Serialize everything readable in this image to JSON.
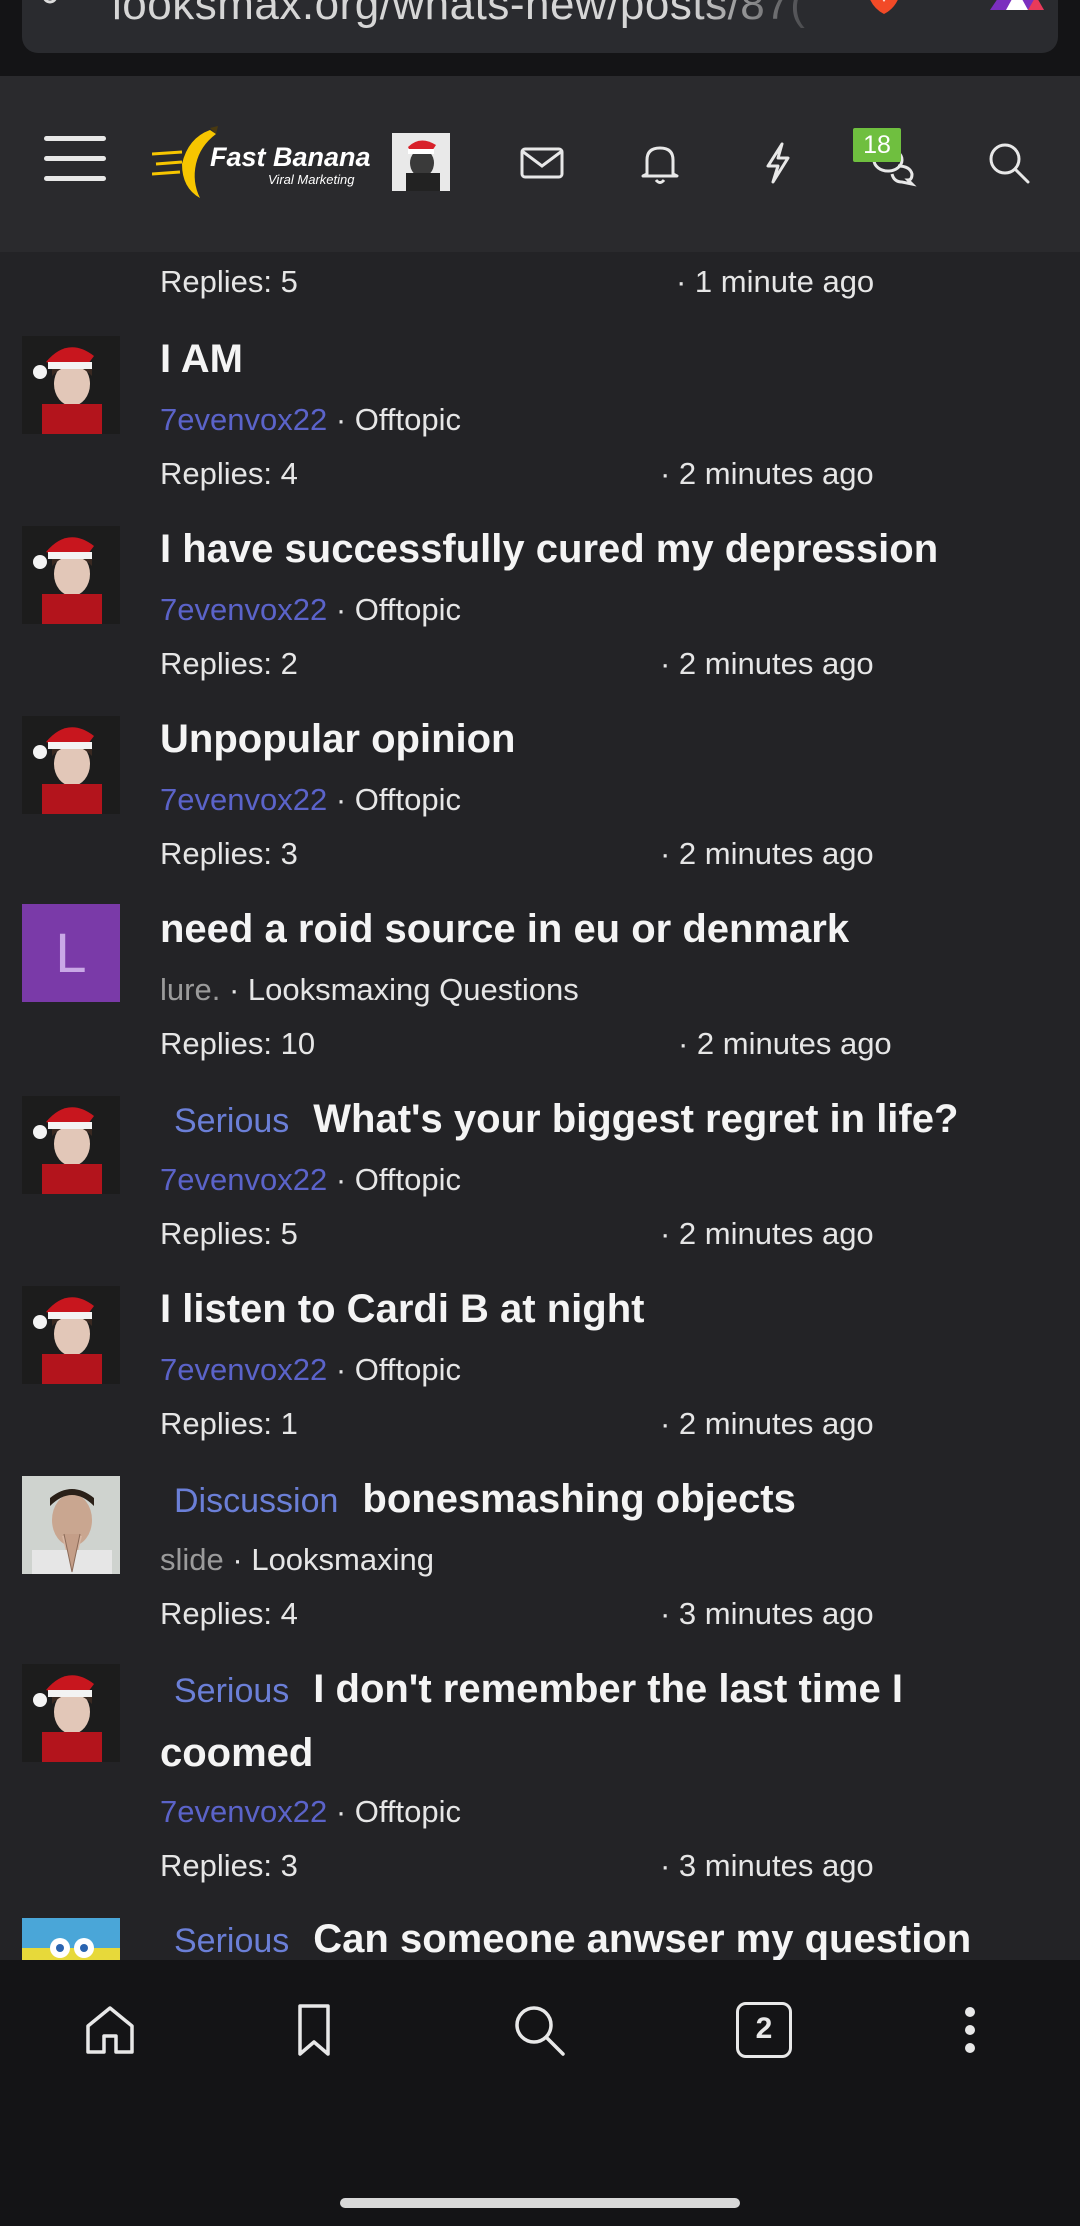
{
  "browser": {
    "url": "looksmax.org/whats-new/posts/87(",
    "tabs_count": "2"
  },
  "header": {
    "logo_title": "Fast Banana",
    "logo_subtitle": "Viral Marketing",
    "alerts_badge": "18"
  },
  "feed": {
    "top_partial": {
      "replies": "Replies: 5",
      "time": "· 1 minute ago"
    },
    "items": [
      {
        "title": "I AM",
        "prefix": "",
        "author": "7evenvox22",
        "forum": "· Offtopic",
        "replies": "Replies: 4",
        "time": "· 2 minutes ago"
      },
      {
        "title": "I have successfully cured my depression",
        "prefix": "",
        "author": "7evenvox22",
        "forum": "· Offtopic",
        "replies": "Replies: 2",
        "time": "· 2 minutes ago"
      },
      {
        "title": "Unpopular opinion",
        "prefix": "",
        "author": "7evenvox22",
        "forum": "· Offtopic",
        "replies": "Replies: 3",
        "time": "· 2 minutes ago"
      },
      {
        "title": "need a roid source in eu or denmark",
        "prefix": "",
        "author": "lure.",
        "forum": "· Looksmaxing Questions",
        "replies": "Replies: 10",
        "time": "· 2 minutes ago",
        "avatar_letter": "L"
      },
      {
        "title": "What's your biggest regret in life?",
        "prefix": "Serious",
        "author": "7evenvox22",
        "forum": "· Offtopic",
        "replies": "Replies: 5",
        "time": "· 2 minutes ago"
      },
      {
        "title": "I listen to Cardi B at night",
        "prefix": "",
        "author": "7evenvox22",
        "forum": "· Offtopic",
        "replies": "Replies: 1",
        "time": "· 2 minutes ago"
      },
      {
        "title": "bonesmashing objects",
        "prefix": "Discussion",
        "author": "slide",
        "forum": "· Looksmaxing",
        "replies": "Replies: 4",
        "time": "· 3 minutes ago"
      },
      {
        "title": "I don't remember the last time I coomed",
        "prefix": "Serious",
        "author": "7evenvox22",
        "forum": "· Offtopic",
        "replies": "Replies: 3",
        "time": "· 3 minutes ago"
      },
      {
        "title": "Can someone anwser my question",
        "prefix": "Serious",
        "author": "",
        "forum": "",
        "replies": "",
        "time": ""
      }
    ]
  },
  "colors": {
    "accent_link": "#5b63c9",
    "prefix_blue": "#6b7fd7",
    "badge_green": "#6fbf3f",
    "avatar_purple": "#7a3aa8"
  }
}
